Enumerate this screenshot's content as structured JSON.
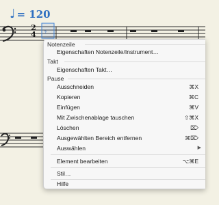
{
  "tempo": {
    "note_symbol": "♩",
    "text": "= 120"
  },
  "time_signature": {
    "numerator": "2",
    "denominator": "4"
  },
  "context_menu": {
    "sections": {
      "notenzeile": "Notenzeile",
      "takt": "Takt",
      "pause": "Pause"
    },
    "items": {
      "eigenschaften_notenzeile": "Eigenschaften Notenzeile/Instrument…",
      "eigenschaften_takt": "Eigenschaften Takt…",
      "ausschneiden": {
        "label": "Ausschneiden",
        "shortcut": "⌘X"
      },
      "kopieren": {
        "label": "Kopieren",
        "shortcut": "⌘C"
      },
      "einfuegen": {
        "label": "Einfügen",
        "shortcut": "⌘V"
      },
      "zwischenablage_tauschen": {
        "label": "Mit Zwischenablage tauschen",
        "shortcut": "⇧⌘X"
      },
      "loeschen": {
        "label": "Löschen",
        "shortcut": "⌦"
      },
      "bereich_entfernen": {
        "label": "Ausgewählten Bereich entfernen",
        "shortcut": "⌘⌦"
      },
      "auswaehlen": {
        "label": "Auswählen",
        "submenu_glyph": "▶"
      },
      "element_bearbeiten": {
        "label": "Element bearbeiten",
        "shortcut": "⌥⌘E"
      },
      "stil": "Stil…",
      "hilfe": "Hilfe"
    }
  }
}
